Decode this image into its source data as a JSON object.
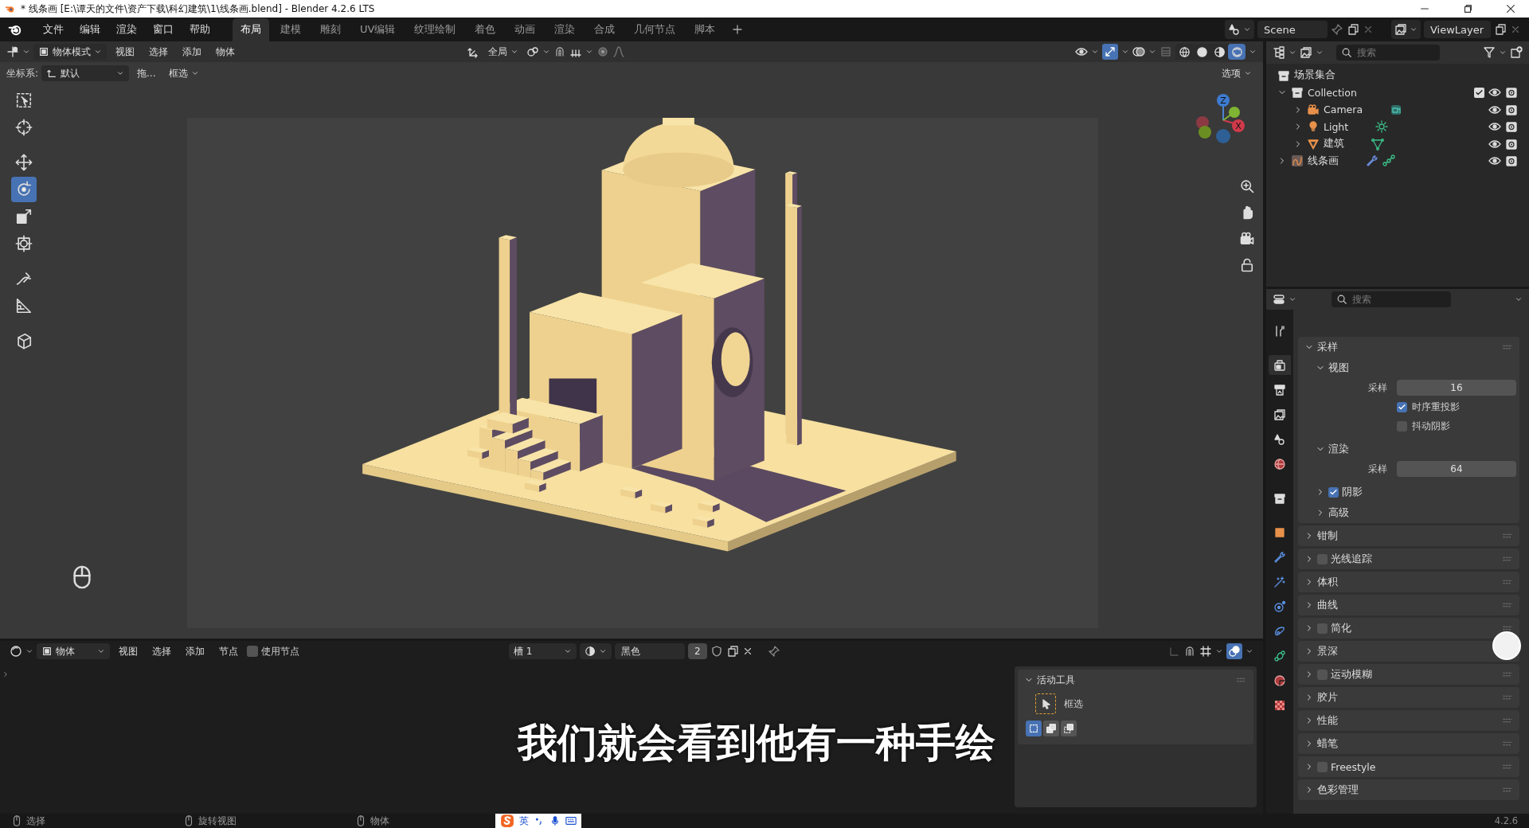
{
  "window": {
    "title": "* 线条画 [E:\\谭天的文件\\资产下载\\科幻建筑\\1\\线条画.blend] - Blender 4.2.6 LTS"
  },
  "menu": [
    "文件",
    "编辑",
    "渲染",
    "窗口",
    "帮助"
  ],
  "workspaces": [
    {
      "label": "布局",
      "selected": true
    },
    {
      "label": "建模",
      "selected": false
    },
    {
      "label": "雕刻",
      "selected": false
    },
    {
      "label": "UV编辑",
      "selected": false
    },
    {
      "label": "纹理绘制",
      "selected": false
    },
    {
      "label": "着色",
      "selected": false
    },
    {
      "label": "动画",
      "selected": false
    },
    {
      "label": "渲染",
      "selected": false
    },
    {
      "label": "合成",
      "selected": false
    },
    {
      "label": "几何节点",
      "selected": false
    },
    {
      "label": "脚本",
      "selected": false
    }
  ],
  "scene": {
    "scene": "Scene",
    "view_layer": "ViewLayer"
  },
  "viewport": {
    "mode": "物体模式",
    "menus": [
      "视图",
      "选择",
      "添加",
      "物体"
    ],
    "orientation": "全局",
    "coord_label": "坐标系:",
    "coord_value": "默认",
    "drag": "拖...",
    "select_mode": "框选",
    "options": "选项",
    "shading": [
      {
        "kind": "wireframe",
        "selected": false
      },
      {
        "kind": "solid",
        "selected": false
      },
      {
        "kind": "material",
        "selected": false
      },
      {
        "kind": "rendered",
        "selected": true
      }
    ],
    "tools": [
      {
        "kind": "select_box",
        "selected": false
      },
      {
        "kind": "cursor",
        "selected": false
      },
      {
        "kind": "move",
        "selected": false
      },
      {
        "kind": "rotate",
        "selected": true
      },
      {
        "kind": "scale",
        "selected": false
      },
      {
        "kind": "transform",
        "selected": false
      },
      {
        "kind": "annotate",
        "selected": false
      },
      {
        "kind": "measure",
        "selected": false
      },
      {
        "kind": "add_cube",
        "selected": false
      }
    ],
    "gizmo": {
      "z": "Z",
      "x": "X"
    }
  },
  "outliner": {
    "search_placeholder": "搜索",
    "root": "场景集合",
    "items": [
      {
        "label": "Collection",
        "kind": "collection",
        "expanded": true,
        "checked": true,
        "children": [
          {
            "label": "Camera",
            "kind": "camera",
            "expanded": false
          },
          {
            "label": "Light",
            "kind": "light",
            "expanded": false
          },
          {
            "label": "建筑",
            "kind": "mesh",
            "expanded": false
          }
        ]
      },
      {
        "label": "线条画",
        "kind": "grease_pencil",
        "expanded": false
      }
    ]
  },
  "properties": {
    "search_placeholder": "搜索",
    "tabs": [
      {
        "kind": "tool",
        "selected": false
      },
      {
        "kind": "render",
        "selected": true
      },
      {
        "kind": "output",
        "selected": false
      },
      {
        "kind": "view_layer",
        "selected": false
      },
      {
        "kind": "scene",
        "selected": false
      },
      {
        "kind": "world",
        "selected": false
      },
      {
        "kind": "collection",
        "selected": false
      },
      {
        "kind": "object",
        "selected": false
      },
      {
        "kind": "modifiers",
        "selected": false
      },
      {
        "kind": "particles",
        "selected": false
      },
      {
        "kind": "physics",
        "selected": false
      },
      {
        "kind": "constraints",
        "selected": false
      },
      {
        "kind": "data",
        "selected": false
      },
      {
        "kind": "material",
        "selected": false
      },
      {
        "kind": "texture",
        "selected": false
      }
    ],
    "sections": [
      {
        "label": "采样",
        "expanded": true,
        "subpanels": [
          {
            "label": "视图",
            "expanded": true,
            "rows": [
              {
                "kind": "number",
                "label": "采样",
                "value": "16"
              },
              {
                "kind": "checkbox",
                "label": "时序重投影",
                "checked": true
              },
              {
                "kind": "checkbox",
                "label": "抖动阴影",
                "checked": false
              }
            ]
          },
          {
            "label": "渲染",
            "expanded": true,
            "rows": [
              {
                "kind": "number",
                "label": "采样",
                "value": "64"
              }
            ]
          },
          {
            "label": "阴影",
            "expanded": false,
            "checked": true
          },
          {
            "label": "高级",
            "expanded": false
          }
        ]
      },
      {
        "label": "钳制",
        "expanded": false
      },
      {
        "label": "光线追踪",
        "expanded": false,
        "checked": false
      },
      {
        "label": "体积",
        "expanded": false
      },
      {
        "label": "曲线",
        "expanded": false
      },
      {
        "label": "简化",
        "expanded": false,
        "checked": false
      },
      {
        "label": "景深",
        "expanded": false
      },
      {
        "label": "运动模糊",
        "expanded": false,
        "checked": false
      },
      {
        "label": "胶片",
        "expanded": false
      },
      {
        "label": "性能",
        "expanded": false
      },
      {
        "label": "蜡笔",
        "expanded": false
      },
      {
        "label": "Freestyle",
        "expanded": false,
        "checked": false
      },
      {
        "label": "色彩管理",
        "expanded": false
      }
    ]
  },
  "node_editor": {
    "object": "物体",
    "menus": [
      "视图",
      "选择",
      "添加",
      "节点"
    ],
    "use_nodes": {
      "label": "使用节点",
      "checked": false
    },
    "slot": "槽 1",
    "material": "黑色",
    "users": "2",
    "sidebar": {
      "title": "活动工具",
      "expanded": true,
      "tool": "框选",
      "modes": [
        {
          "selected": true
        },
        {
          "selected": false
        },
        {
          "selected": false
        }
      ]
    }
  },
  "subtitle": "我们就会看到他有一种手绘",
  "status_bar": {
    "items": [
      "选择",
      "旋转视图",
      "物体"
    ],
    "ime": "英",
    "version": "4.2.6"
  }
}
